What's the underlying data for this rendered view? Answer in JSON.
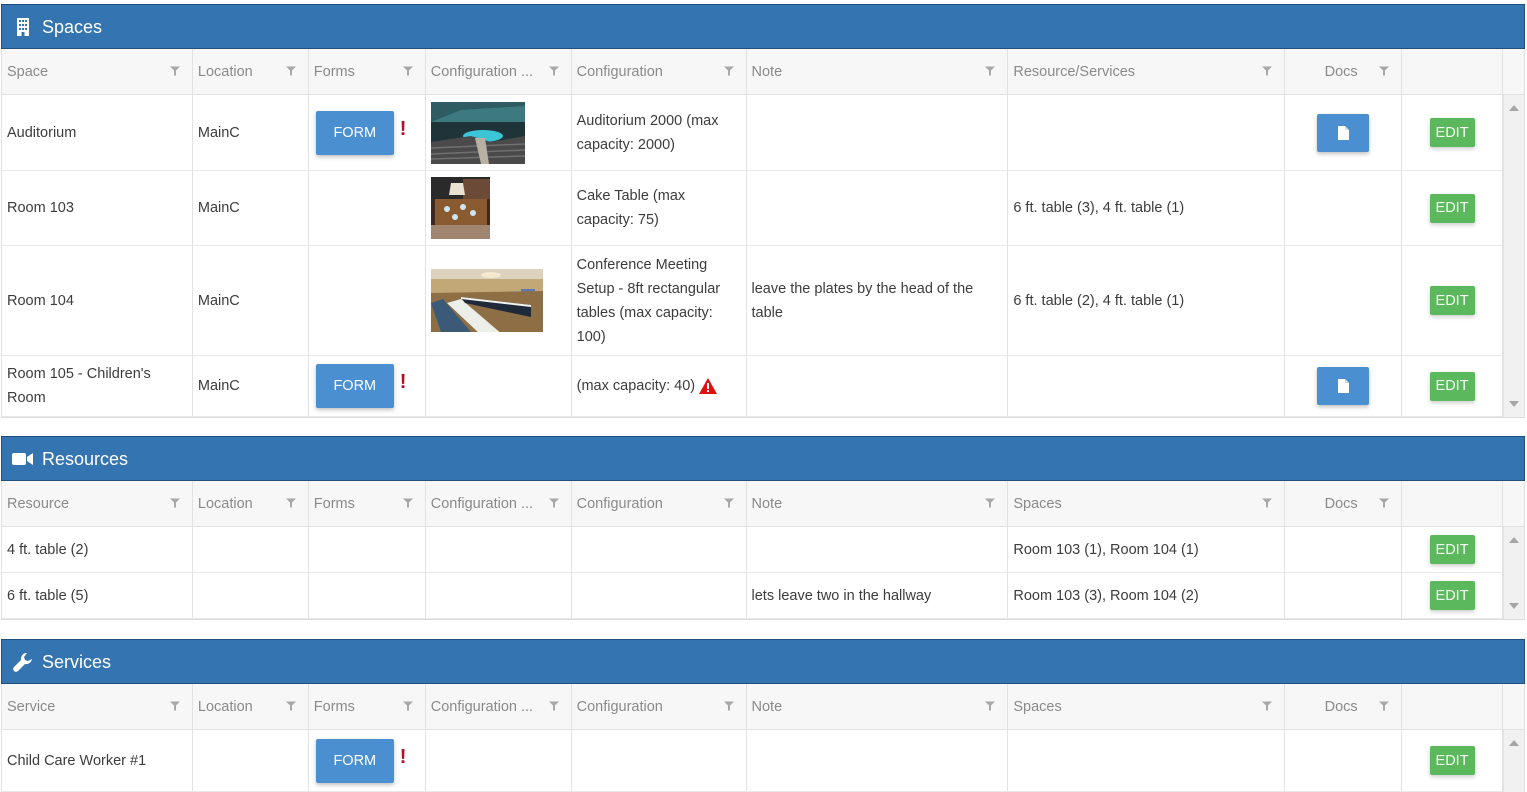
{
  "colors": {
    "header_bg": "#3474b0",
    "form_button": "#4a8fd0",
    "edit_button": "#5cb85c",
    "warning": "#b0102a"
  },
  "panels": {
    "spaces": {
      "title": "Spaces",
      "icon": "building-icon",
      "columns": [
        "Space",
        "Location",
        "Forms",
        "Configuration ...",
        "Configuration",
        "Note",
        "Resource/Services",
        "Docs",
        ""
      ],
      "rows": [
        {
          "space": "Auditorium",
          "location": "MainC",
          "form": "FORM",
          "form_flag": "!",
          "config_image": "auditorium-photo",
          "configuration": "Auditorium 2000 (max capacity: 2000)",
          "note": "",
          "resources": "",
          "has_doc": true,
          "edit": "EDIT"
        },
        {
          "space": "Room 103",
          "location": "MainC",
          "form": "",
          "form_flag": "",
          "config_image": "cake-table-photo",
          "configuration": "Cake Table (max capacity: 75)",
          "note": "",
          "resources": "6 ft. table (3), 4 ft. table (1)",
          "has_doc": false,
          "edit": "EDIT"
        },
        {
          "space": "Room 104",
          "location": "MainC",
          "form": "",
          "form_flag": "",
          "config_image": "conference-room-photo",
          "configuration": "Conference Meeting Setup - 8ft rectangular tables (max capacity: 100)",
          "note": "leave the plates by the head of the table",
          "resources": "6 ft. table (2), 4 ft. table (1)",
          "has_doc": false,
          "edit": "EDIT"
        },
        {
          "space": "Room 105 - Children's Room",
          "location": "MainC",
          "form": "FORM",
          "form_flag": "!",
          "config_image": "",
          "configuration": "(max capacity: 40)",
          "config_warning": true,
          "note": "",
          "resources": "",
          "has_doc": true,
          "edit": "EDIT"
        }
      ]
    },
    "resources": {
      "title": "Resources",
      "icon": "video-camera-icon",
      "columns": [
        "Resource",
        "Location",
        "Forms",
        "Configuration ...",
        "Configuration",
        "Note",
        "Spaces",
        "Docs",
        ""
      ],
      "rows": [
        {
          "resource": "4 ft. table (2)",
          "note": "",
          "spaces": "Room 103 (1), Room 104 (1)",
          "edit": "EDIT"
        },
        {
          "resource": "6 ft. table (5)",
          "note": "lets leave two in the hallway",
          "spaces": "Room 103 (3), Room 104 (2)",
          "edit": "EDIT"
        }
      ]
    },
    "services": {
      "title": "Services",
      "icon": "wrench-icon",
      "columns": [
        "Service",
        "Location",
        "Forms",
        "Configuration ...",
        "Configuration",
        "Note",
        "Spaces",
        "Docs",
        ""
      ],
      "rows": [
        {
          "service": "Child Care Worker #1",
          "form": "FORM",
          "form_flag": "!",
          "edit": "EDIT"
        }
      ]
    }
  }
}
